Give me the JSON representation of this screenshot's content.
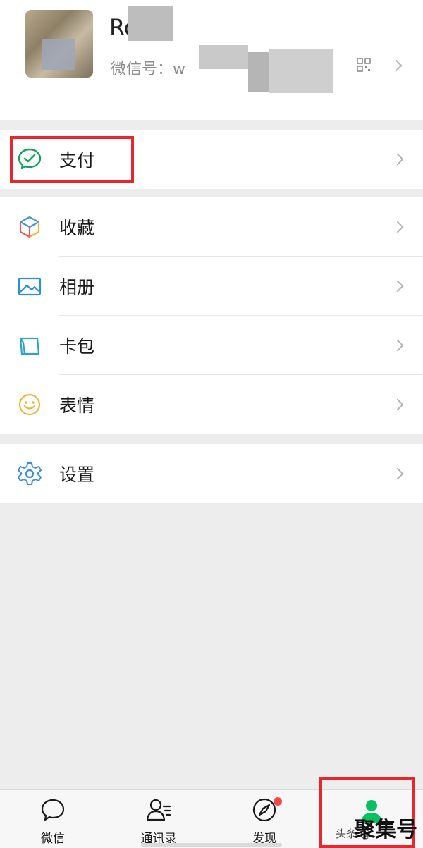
{
  "profile": {
    "name": "Ro",
    "wechat_id": "微信号：w"
  },
  "groups": {
    "pay": [
      {
        "label": "支付",
        "icon": "wechat-pay-icon"
      }
    ],
    "main": [
      {
        "label": "收藏",
        "icon": "favorites-cube-icon"
      },
      {
        "label": "相册",
        "icon": "album-icon"
      },
      {
        "label": "卡包",
        "icon": "card-wallet-icon"
      },
      {
        "label": "表情",
        "icon": "sticker-smiley-icon"
      }
    ],
    "settings": [
      {
        "label": "设置",
        "icon": "gear-icon"
      }
    ]
  },
  "tabbar": {
    "items": [
      {
        "label": "微信",
        "icon": "chat-bubble-icon"
      },
      {
        "label": "通讯录",
        "icon": "contacts-icon"
      },
      {
        "label": "发现",
        "icon": "compass-icon"
      },
      {
        "label": "",
        "icon": "me-person-icon"
      }
    ],
    "active_color": "#07c160"
  },
  "watermark": {
    "text": "聚集号",
    "sub": "头条 @"
  },
  "colors": {
    "highlight": "#e8262e",
    "background": "#ededed",
    "accent": "#07c160"
  }
}
